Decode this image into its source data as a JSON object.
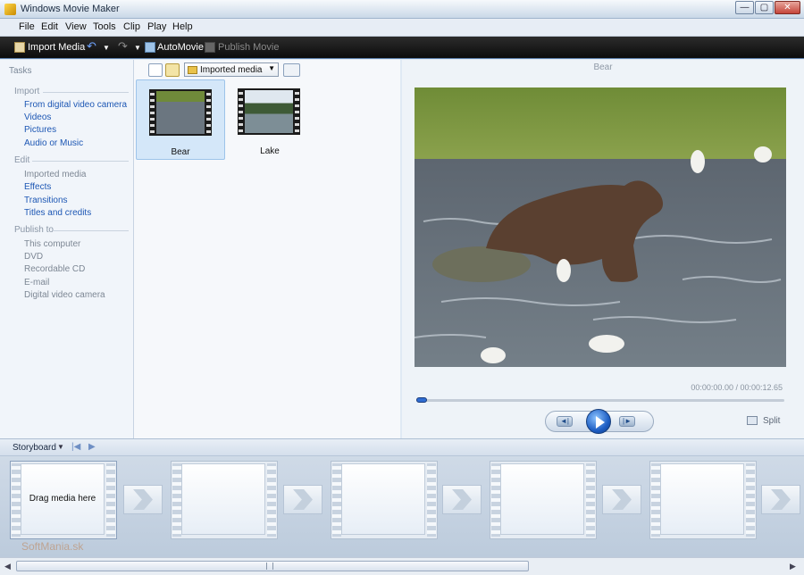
{
  "window": {
    "title": "Windows Movie Maker"
  },
  "menu": [
    "File",
    "Edit",
    "View",
    "Tools",
    "Clip",
    "Play",
    "Help"
  ],
  "toolbar": {
    "import_media": "Import Media",
    "automovie": "AutoMovie",
    "publish_movie": "Publish Movie"
  },
  "tasks": {
    "header": "Tasks",
    "import_section": "Import",
    "import_items": [
      "From digital video camera",
      "Videos",
      "Pictures",
      "Audio or Music"
    ],
    "edit_section": "Edit",
    "edit_items": [
      "Imported media",
      "Effects",
      "Transitions",
      "Titles and credits"
    ],
    "publish_section": "Publish to",
    "publish_items": [
      "This computer",
      "DVD",
      "Recordable CD",
      "E-mail",
      "Digital video camera"
    ]
  },
  "media": {
    "collection": "Imported media",
    "items": [
      {
        "label": "Bear",
        "selected": true
      },
      {
        "label": "Lake",
        "selected": false
      }
    ]
  },
  "preview": {
    "title": "Bear",
    "timecode": "00:00:00.00 / 00:00:12.65",
    "split_label": "Split",
    "progress": 0
  },
  "storyboard": {
    "label": "Storyboard",
    "drag_text": "Drag media here",
    "watermark": "SoftMania.sk"
  },
  "colors": {
    "accent": "#2f6cd1",
    "toolbar": "#1a1a1a",
    "link": "#1d57b4"
  }
}
